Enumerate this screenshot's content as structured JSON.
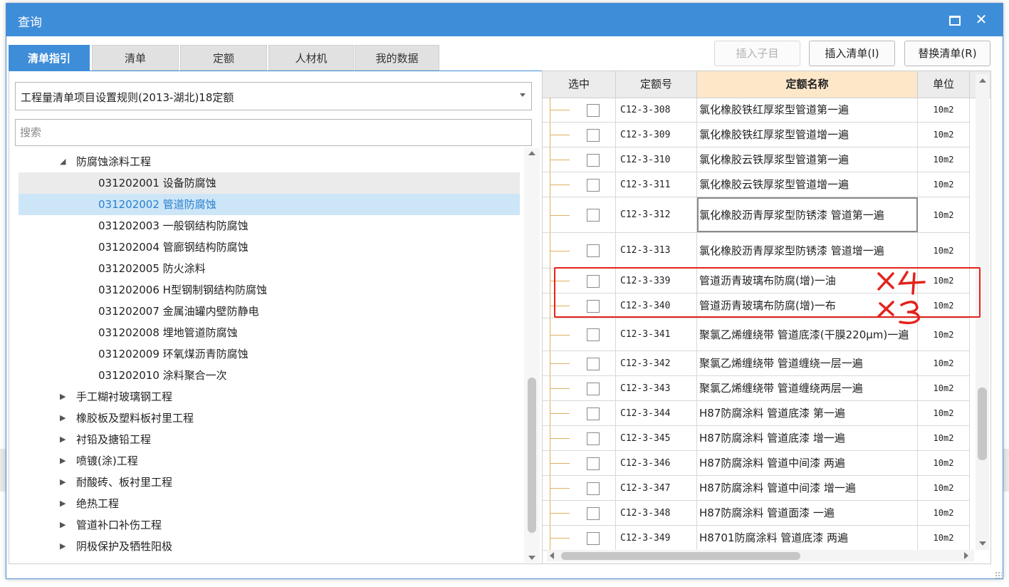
{
  "dialog": {
    "title": "查询"
  },
  "tabs": [
    {
      "label": "清单指引",
      "active": true
    },
    {
      "label": "清单",
      "active": false
    },
    {
      "label": "定额",
      "active": false
    },
    {
      "label": "人材机",
      "active": false
    },
    {
      "label": "我的数据",
      "active": false
    }
  ],
  "toolbar": {
    "insert_child": "插入子目",
    "insert_list": "插入清单(I)",
    "replace_list": "替换清单(R)"
  },
  "rule_select": {
    "value": "工程量清单项目设置规则(2013-湖北)18定额"
  },
  "search": {
    "placeholder": "搜索",
    "value": ""
  },
  "tree": [
    {
      "text": "防腐蚀涂料工程",
      "level": 1,
      "expanded": true,
      "state": "normal"
    },
    {
      "text": "031202001  设备防腐蚀",
      "level": 2,
      "state": "hover"
    },
    {
      "text": "031202002  管道防腐蚀",
      "level": 2,
      "state": "selected"
    },
    {
      "text": "031202003  一般钢结构防腐蚀",
      "level": 2,
      "state": "normal"
    },
    {
      "text": "031202004  管廊钢结构防腐蚀",
      "level": 2,
      "state": "normal"
    },
    {
      "text": "031202005  防火涂料",
      "level": 2,
      "state": "normal"
    },
    {
      "text": "031202006  H型钢制钢结构防腐蚀",
      "level": 2,
      "state": "normal"
    },
    {
      "text": "031202007  金属油罐内壁防静电",
      "level": 2,
      "state": "normal"
    },
    {
      "text": "031202008  埋地管道防腐蚀",
      "level": 2,
      "state": "normal"
    },
    {
      "text": "031202009  环氧煤沥青防腐蚀",
      "level": 2,
      "state": "normal"
    },
    {
      "text": "031202010  涂料聚合一次",
      "level": 2,
      "state": "normal"
    },
    {
      "text": "手工糊衬玻璃钢工程",
      "level": 1,
      "expanded": false,
      "state": "normal"
    },
    {
      "text": "橡胶板及塑料板衬里工程",
      "level": 1,
      "expanded": false,
      "state": "normal"
    },
    {
      "text": "衬铅及搪铅工程",
      "level": 1,
      "expanded": false,
      "state": "normal"
    },
    {
      "text": "喷镀(涂)工程",
      "level": 1,
      "expanded": false,
      "state": "normal"
    },
    {
      "text": "耐酸砖、板衬里工程",
      "level": 1,
      "expanded": false,
      "state": "normal"
    },
    {
      "text": "绝热工程",
      "level": 1,
      "expanded": false,
      "state": "normal"
    },
    {
      "text": "管道补口补伤工程",
      "level": 1,
      "expanded": false,
      "state": "normal"
    },
    {
      "text": "阴极保护及牺牲阳极",
      "level": 1,
      "expanded": false,
      "state": "normal"
    }
  ],
  "grid": {
    "headers": {
      "select": "选中",
      "code": "定额号",
      "name": "定额名称",
      "unit": "单位"
    },
    "rows": [
      {
        "code": "C12-3-308",
        "name": "氯化橡胶铁红厚浆型管道第一遍",
        "unit": "10m2"
      },
      {
        "code": "C12-3-309",
        "name": "氯化橡胶铁红厚浆型管道增一遍",
        "unit": "10m2"
      },
      {
        "code": "C12-3-310",
        "name": "氯化橡胶云铁厚浆型管道第一遍",
        "unit": "10m2"
      },
      {
        "code": "C12-3-311",
        "name": "氯化橡胶云铁厚浆型管道增一遍",
        "unit": "10m2"
      },
      {
        "code": "C12-3-312",
        "name": "氯化橡胶沥青厚浆型防锈漆 管道第一遍",
        "unit": "10m2"
      },
      {
        "code": "C12-3-313",
        "name": "氯化橡胶沥青厚浆型防锈漆 管道增一遍",
        "unit": "10m2"
      },
      {
        "code": "C12-3-339",
        "name": "管道沥青玻璃布防腐(增)一油",
        "unit": "10m2"
      },
      {
        "code": "C12-3-340",
        "name": "管道沥青玻璃布防腐(增)一布",
        "unit": "10m2"
      },
      {
        "code": "C12-3-341",
        "name": "聚氯乙烯缠绕带 管道底漆(干膜220μm)一遍",
        "unit": "10m2"
      },
      {
        "code": "C12-3-342",
        "name": "聚氯乙烯缠绕带 管道缠绕一层一遍",
        "unit": "10m2"
      },
      {
        "code": "C12-3-343",
        "name": "聚氯乙烯缠绕带 管道缠绕两层一遍",
        "unit": "10m2"
      },
      {
        "code": "C12-3-344",
        "name": "H87防腐涂料 管道底漆 第一遍",
        "unit": "10m2"
      },
      {
        "code": "C12-3-345",
        "name": "H87防腐涂料 管道底漆 增一遍",
        "unit": "10m2"
      },
      {
        "code": "C12-3-346",
        "name": "H87防腐涂料 管道中间漆 两遍",
        "unit": "10m2"
      },
      {
        "code": "C12-3-347",
        "name": "H87防腐涂料 管道中间漆 增一遍",
        "unit": "10m2"
      },
      {
        "code": "C12-3-348",
        "name": "H87防腐涂料 管道面漆 一遍",
        "unit": "10m2"
      },
      {
        "code": "C12-3-349",
        "name": "H8701防腐涂料 管道底漆 两遍",
        "unit": "10m2"
      }
    ]
  },
  "annotations": {
    "mark1": "×4",
    "mark2": "×3",
    "color": "#e3231c"
  },
  "colors": {
    "accent": "#3e8dd8",
    "selected_bg": "#cde6f7",
    "sorted_header_bg": "#fde7c9"
  }
}
